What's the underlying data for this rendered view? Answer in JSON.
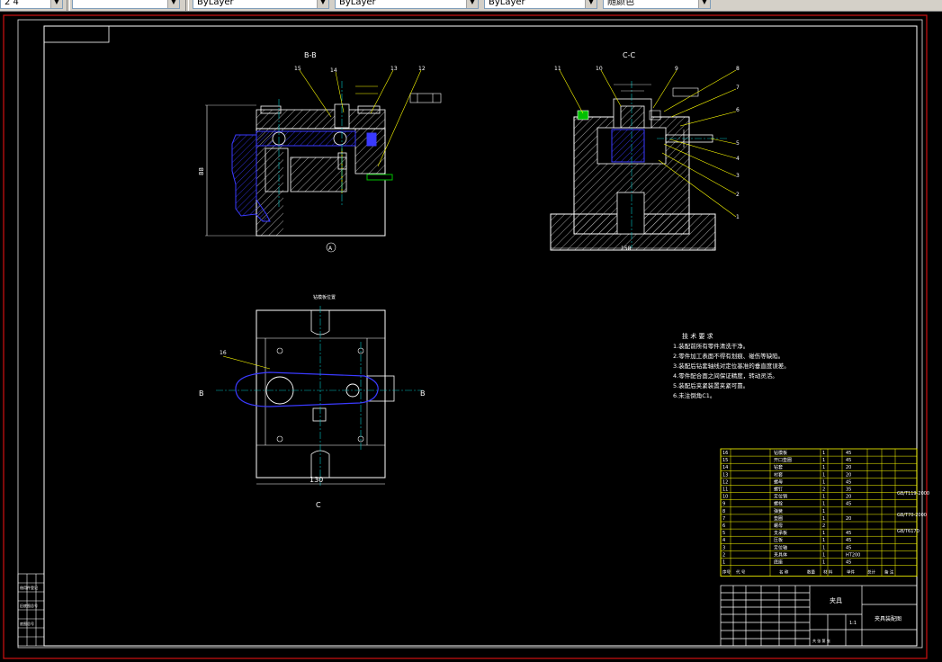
{
  "toolbar": {
    "combo1": "2 4",
    "combo2": "",
    "layer1": "ByLayer",
    "layer2": "ByLayer",
    "layer3": "ByLayer",
    "combo6": "随颜色"
  },
  "views": {
    "section_bb": "B-B",
    "section_cc": "C-C",
    "view_c": "C",
    "arrow_b_left": "B",
    "arrow_b_right": "B",
    "dim_130": "130",
    "dim_height": "88",
    "dim_base_cc": "158",
    "label_pos_top": "钻模板位置",
    "datum_a": "A"
  },
  "balloons_bb": [
    "15",
    "14",
    "13",
    "12"
  ],
  "balloons_cc": [
    "11",
    "10",
    "9",
    "8",
    "7",
    "6",
    "5",
    "4",
    "3",
    "2",
    "1"
  ],
  "balloon_plan": "16",
  "tech_requirements": {
    "title": "技 术 要 求",
    "items": [
      "1.装配前所有零件清洗干净。",
      "2.零件加工表面不得有划痕、碰伤等缺陷。",
      "3.装配后钻套轴线对定位基准的垂直度误差。",
      "4.零件配合面之间保证精度，转动灵活。",
      "5.装配后夹紧装置夹紧可靠。",
      "6.未注倒角C1。"
    ]
  },
  "bom_rows": [
    {
      "no": "16",
      "name": "钻模板",
      "qty": "1",
      "mat": "45"
    },
    {
      "no": "15",
      "name": "开口垫圈",
      "qty": "1",
      "mat": "45"
    },
    {
      "no": "14",
      "name": "钻套",
      "qty": "1",
      "mat": "20"
    },
    {
      "no": "13",
      "name": "衬套",
      "qty": "1",
      "mat": "20"
    },
    {
      "no": "12",
      "name": "螺母",
      "qty": "1",
      "mat": "45"
    },
    {
      "no": "11",
      "name": "螺钉",
      "qty": "2",
      "mat": "35"
    },
    {
      "no": "10",
      "name": "定位销",
      "qty": "1",
      "mat": "20"
    },
    {
      "no": "9",
      "name": "螺栓",
      "qty": "1",
      "mat": "45"
    },
    {
      "no": "8",
      "name": "弹簧",
      "qty": "1",
      "mat": ""
    },
    {
      "no": "7",
      "name": "垫圈",
      "qty": "1",
      "mat": "20"
    },
    {
      "no": "6",
      "name": "螺母",
      "qty": "2",
      "mat": ""
    },
    {
      "no": "5",
      "name": "支承板",
      "qty": "1",
      "mat": "45"
    },
    {
      "no": "4",
      "name": "压板",
      "qty": "1",
      "mat": "45"
    },
    {
      "no": "3",
      "name": "定位轴",
      "qty": "1",
      "mat": "45"
    },
    {
      "no": "2",
      "name": "夹具体",
      "qty": "1",
      "mat": "HT200"
    },
    {
      "no": "1",
      "name": "底座",
      "qty": "1",
      "mat": "45"
    }
  ],
  "bom_notes": [
    "GB/T119-2000",
    "GB/T70-2000",
    "GB/T6170"
  ],
  "bom_header": [
    "序号",
    "代 号",
    "名 称",
    "数量",
    "材 料",
    "单件",
    "总计",
    "备 注"
  ],
  "title_block": {
    "part": "夹具",
    "drawing_name": "夹具装配图",
    "scale": "1:1",
    "sheet": "共 张 第 张"
  },
  "left_stamp": [
    "借用件登记",
    "",
    "旧底图总号",
    "底图总号"
  ]
}
